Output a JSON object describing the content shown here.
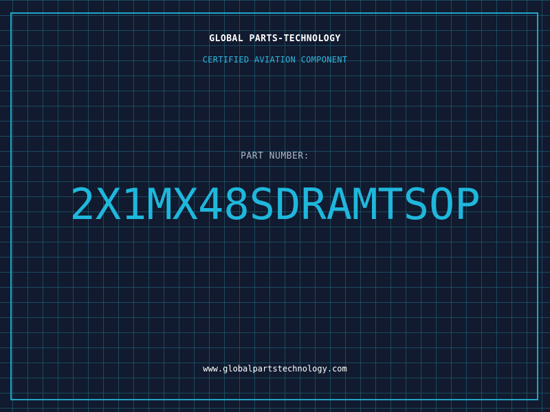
{
  "header": {
    "company": "GLOBAL PARTS-TECHNOLOGY",
    "subtitle": "CERTIFIED AVIATION COMPONENT"
  },
  "part": {
    "label": "PART NUMBER:",
    "number": "2X1MX48SDRAMTSOP"
  },
  "footer": {
    "url": "www.globalpartstechnology.com"
  },
  "colors": {
    "background": "#111a2e",
    "grid": "#217087",
    "accent": "#1fb7dc",
    "frame": "#22a6c9"
  }
}
